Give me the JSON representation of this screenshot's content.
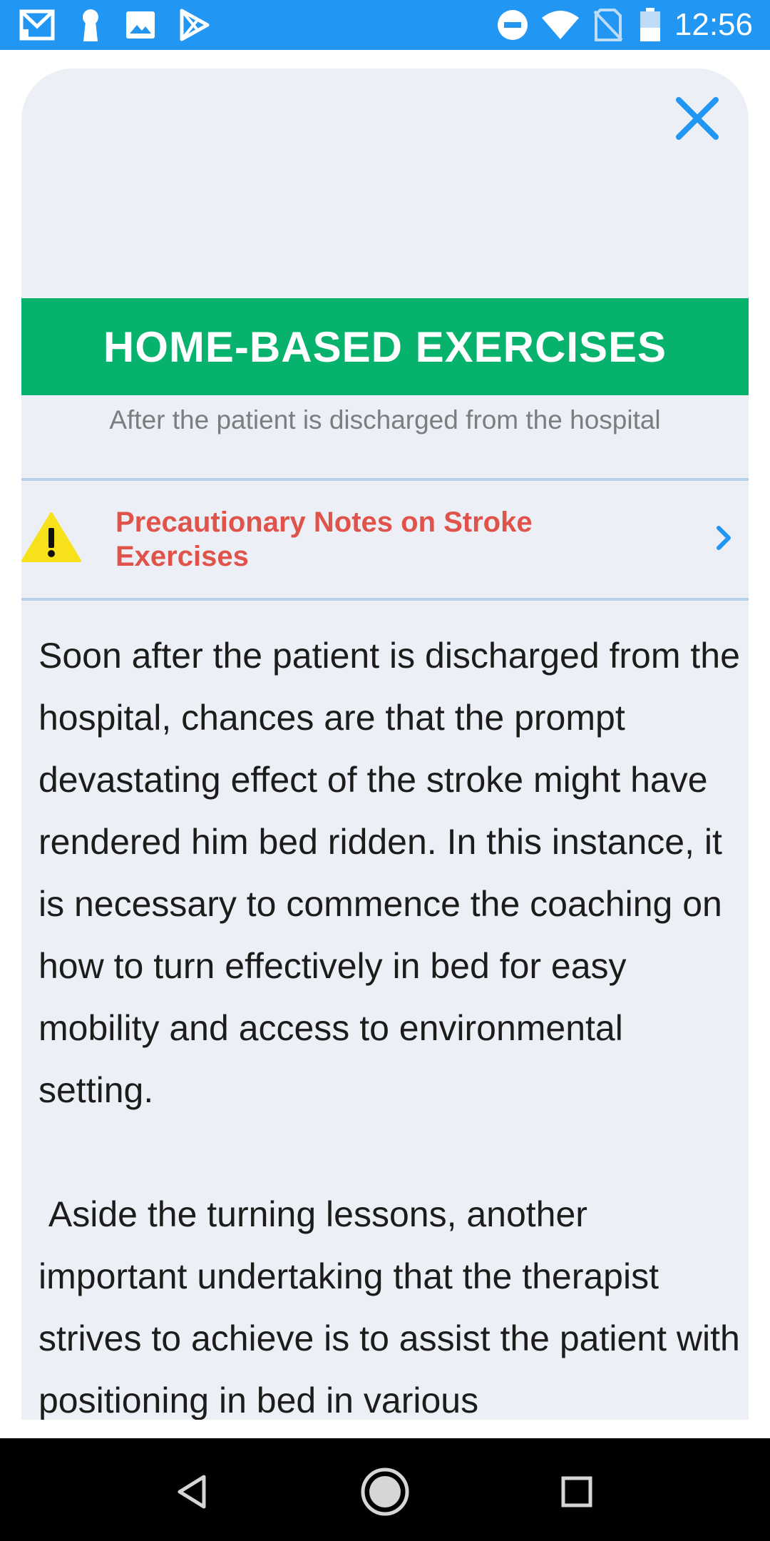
{
  "status_bar": {
    "time": "12:56",
    "icons": [
      "gmail-icon",
      "keyhole-icon",
      "image-icon",
      "play-store-icon",
      "do-not-disturb-icon",
      "wifi-icon",
      "no-sim-icon",
      "battery-icon"
    ]
  },
  "header": {
    "close_icon": "close-icon",
    "title": "HOME-BASED EXERCISES",
    "subtitle": "After the patient is discharged from the hospital"
  },
  "precaution": {
    "icon": "warning-icon",
    "label": "Precautionary Notes on Stroke Exercises",
    "chevron": "chevron-right-icon"
  },
  "content": {
    "paragraph_1": "Soon after the patient is discharged from the hospital, chances are that the prompt devastating effect of the stroke might have rendered him bed ridden. In this instance, it is necessary to commence the coaching on how to turn effectively in bed for easy mobility and access to environmental setting.",
    "paragraph_2": " Aside the turning lessons, another important undertaking that the therapist strives to achieve is to assist the patient with positioning in bed in various"
  },
  "nav_bar": {
    "buttons": [
      "back-icon",
      "home-icon",
      "recents-icon"
    ]
  },
  "colors": {
    "status_bar": "#2196f3",
    "header_band": "#07b26c",
    "card_bg": "#eceff5",
    "accent_blue": "#2196f3",
    "warning_text": "#e0534a",
    "divider": "#b7d1ea"
  }
}
